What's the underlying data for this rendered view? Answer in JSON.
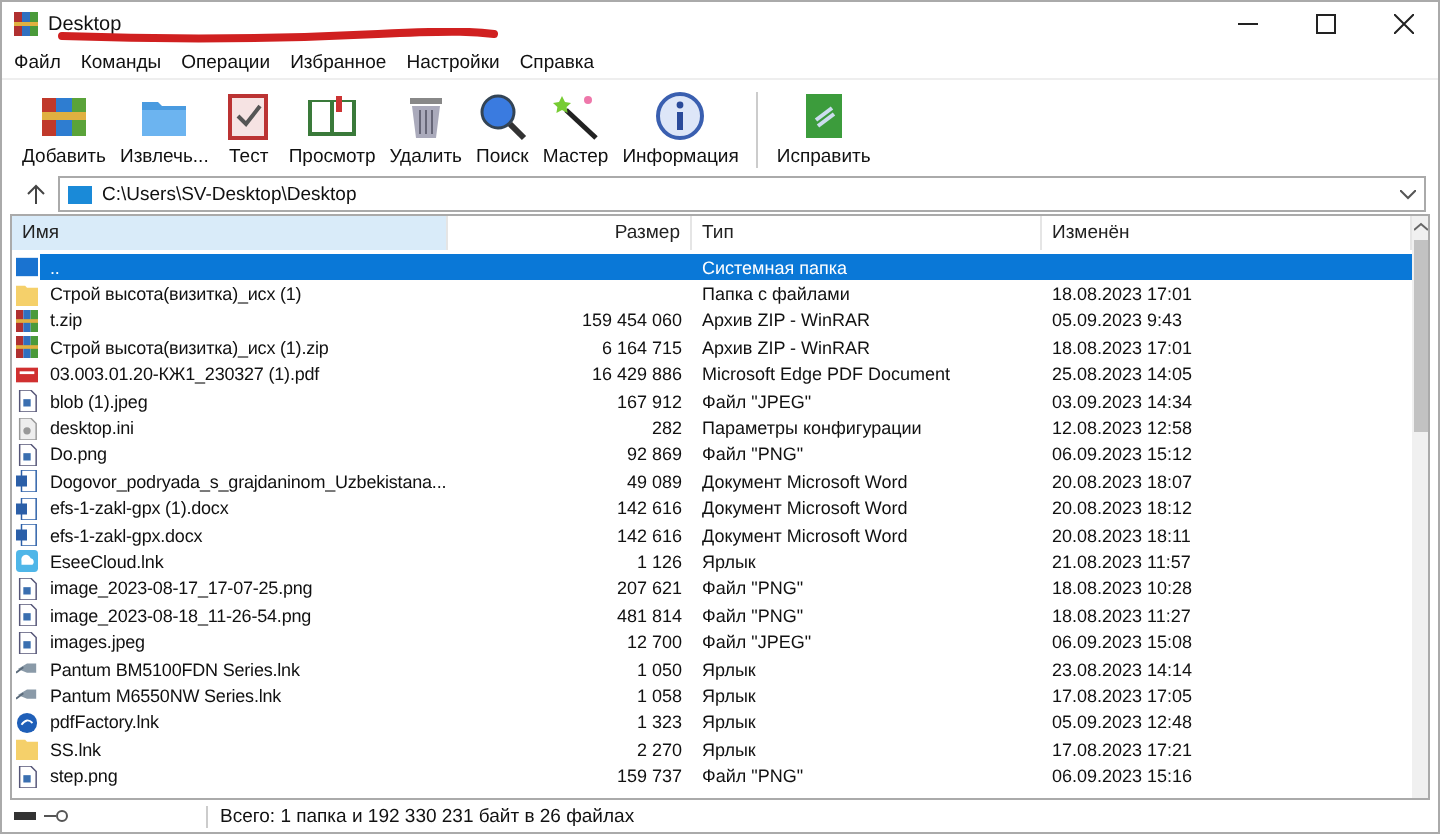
{
  "window": {
    "title": "Desktop"
  },
  "menu": [
    "Файл",
    "Команды",
    "Операции",
    "Избранное",
    "Настройки",
    "Справка"
  ],
  "toolbar": [
    {
      "label": "Добавить",
      "kind": "add"
    },
    {
      "label": "Извлечь...",
      "kind": "extract"
    },
    {
      "label": "Тест",
      "kind": "test"
    },
    {
      "label": "Просмотр",
      "kind": "view"
    },
    {
      "label": "Удалить",
      "kind": "delete"
    },
    {
      "label": "Поиск",
      "kind": "find"
    },
    {
      "label": "Мастер",
      "kind": "wizard"
    },
    {
      "label": "Информация",
      "kind": "info"
    },
    {
      "label": "Исправить",
      "kind": "repair",
      "separated": true
    }
  ],
  "address": {
    "path": "C:\\Users\\SV-Desktop\\Desktop"
  },
  "table": {
    "columns": [
      "Имя",
      "Размер",
      "Тип",
      "Изменён"
    ],
    "rows": [
      {
        "kind": "up",
        "name": "..",
        "size": "",
        "type": "Системная папка",
        "modified": "",
        "selected": true
      },
      {
        "kind": "folder",
        "name": "Строй высота(визитка)_исх (1)",
        "size": "",
        "type": "Папка с файлами",
        "modified": "18.08.2023 17:01",
        "selected": false
      },
      {
        "kind": "archive",
        "name": "t.zip",
        "size": "159 454 060",
        "type": "Архив ZIP - WinRAR",
        "modified": "05.09.2023 9:43",
        "selected": false
      },
      {
        "kind": "archive",
        "name": "Строй высота(визитка)_исх (1).zip",
        "size": "6 164 715",
        "type": "Архив ZIP - WinRAR",
        "modified": "18.08.2023 17:01",
        "selected": false
      },
      {
        "kind": "pdf",
        "name": "03.003.01.20-КЖ1_230327 (1).pdf",
        "size": "16 429 886",
        "type": "Microsoft Edge PDF Document",
        "modified": "25.08.2023 14:05",
        "selected": false
      },
      {
        "kind": "image",
        "name": "blob (1).jpeg",
        "size": "167 912",
        "type": "Файл \"JPEG\"",
        "modified": "03.09.2023 14:34",
        "selected": false
      },
      {
        "kind": "settings",
        "name": "desktop.ini",
        "size": "282",
        "type": "Параметры конфигурации",
        "modified": "12.08.2023 12:58",
        "selected": false
      },
      {
        "kind": "image",
        "name": "Do.png",
        "size": "92 869",
        "type": "Файл \"PNG\"",
        "modified": "06.09.2023 15:12",
        "selected": false
      },
      {
        "kind": "document",
        "name": "Dogovor_podryada_s_grajdaninom_Uzbekistana...",
        "size": "49 089",
        "type": "Документ Microsoft Word",
        "modified": "20.08.2023 18:07",
        "selected": false
      },
      {
        "kind": "document",
        "name": "efs-1-zakl-gpx (1).docx",
        "size": "142 616",
        "type": "Документ Microsoft Word",
        "modified": "20.08.2023 18:12",
        "selected": false
      },
      {
        "kind": "document",
        "name": "efs-1-zakl-gpx.docx",
        "size": "142 616",
        "type": "Документ Microsoft Word",
        "modified": "20.08.2023 18:11",
        "selected": false
      },
      {
        "kind": "cloud",
        "name": "EseeCloud.lnk",
        "size": "1 126",
        "type": "Ярлык",
        "modified": "21.08.2023 11:57",
        "selected": false
      },
      {
        "kind": "image",
        "name": "image_2023-08-17_17-07-25.png",
        "size": "207 621",
        "type": "Файл \"PNG\"",
        "modified": "18.08.2023 10:28",
        "selected": false
      },
      {
        "kind": "image",
        "name": "image_2023-08-18_11-26-54.png",
        "size": "481 814",
        "type": "Файл \"PNG\"",
        "modified": "18.08.2023 11:27",
        "selected": false
      },
      {
        "kind": "image",
        "name": "images.jpeg",
        "size": "12 700",
        "type": "Файл \"JPEG\"",
        "modified": "06.09.2023 15:08",
        "selected": false
      },
      {
        "kind": "printer",
        "name": "Pantum BM5100FDN Series.lnk",
        "size": "1 050",
        "type": "Ярлык",
        "modified": "23.08.2023 14:14",
        "selected": false
      },
      {
        "kind": "printer",
        "name": "Pantum M6550NW Series.lnk",
        "size": "1 058",
        "type": "Ярлык",
        "modified": "17.08.2023 17:05",
        "selected": false
      },
      {
        "kind": "globe",
        "name": "pdfFactory.lnk",
        "size": "1 323",
        "type": "Ярлык",
        "modified": "05.09.2023 12:48",
        "selected": false
      },
      {
        "kind": "folder",
        "name": "SS.lnk",
        "size": "2 270",
        "type": "Ярлык",
        "modified": "17.08.2023 17:21",
        "selected": false
      },
      {
        "kind": "image",
        "name": "step.png",
        "size": "159 737",
        "type": "Файл \"PNG\"",
        "modified": "06.09.2023 15:16",
        "selected": false
      }
    ]
  },
  "status_bar": {
    "text": "Всего: 1 папка и 192 330 231 байт в 26 файлах"
  }
}
